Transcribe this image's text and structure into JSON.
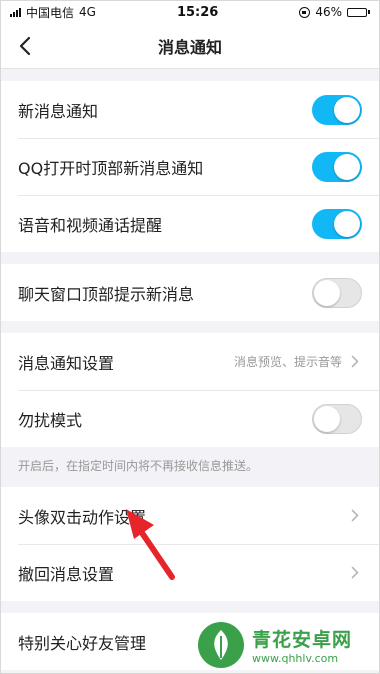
{
  "status_bar": {
    "carrier": "中国电信",
    "network": "4G",
    "time": "15:26",
    "battery_text": "46%",
    "battery_level": 0.46
  },
  "header": {
    "title": "消息通知"
  },
  "sections": {
    "main_toggles": [
      {
        "label": "新消息通知",
        "on": true
      },
      {
        "label": "QQ打开时顶部新消息通知",
        "on": true
      },
      {
        "label": "语音和视频通话提醒",
        "on": true
      }
    ],
    "chat_window": {
      "label": "聊天窗口顶部提示新消息",
      "on": false
    },
    "notify_settings": {
      "label": "消息通知设置",
      "value": "消息预览、提示音等"
    },
    "dnd": {
      "label": "勿扰模式",
      "on": false
    },
    "dnd_note": "开启后，在指定时间内将不再接收信息推送。",
    "avatar_double_tap": {
      "label": "头像双击动作设置"
    },
    "recall": {
      "label": "撤回消息设置"
    },
    "special_friends": {
      "label": "特别关心好友管理"
    }
  },
  "watermark": {
    "name": "青花安卓网",
    "url": "www.qhhlv.com"
  },
  "colors": {
    "accent": "#12b7f5",
    "arrow": "#e8242b",
    "watermark": "#3aa14a"
  }
}
